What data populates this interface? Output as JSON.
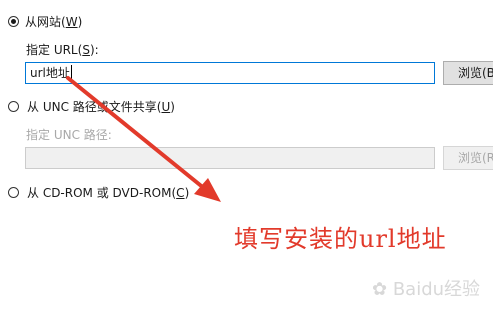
{
  "source_website": {
    "option_label": "从网站(",
    "option_accel": "W",
    "option_suffix": ")",
    "selected": true,
    "url_label": "指定 URL(",
    "url_accel": "S",
    "url_suffix": "):",
    "url_value": "url地址",
    "browse_label": "浏览(B)"
  },
  "source_unc": {
    "option_label": "从 UNC 路径或文件共享(",
    "option_accel": "U",
    "option_suffix": ")",
    "selected": false,
    "path_label": "指定 UNC 路径:",
    "path_value": "",
    "browse_label": "浏览(R)"
  },
  "source_cdrom": {
    "option_label": "从 CD-ROM 或 DVD-ROM(",
    "option_accel": "C",
    "option_suffix": ")",
    "selected": false
  },
  "annotation": {
    "text": "填写安装的url地址",
    "color": "#e23a2b"
  },
  "watermark": {
    "text": "Baidu经验"
  }
}
